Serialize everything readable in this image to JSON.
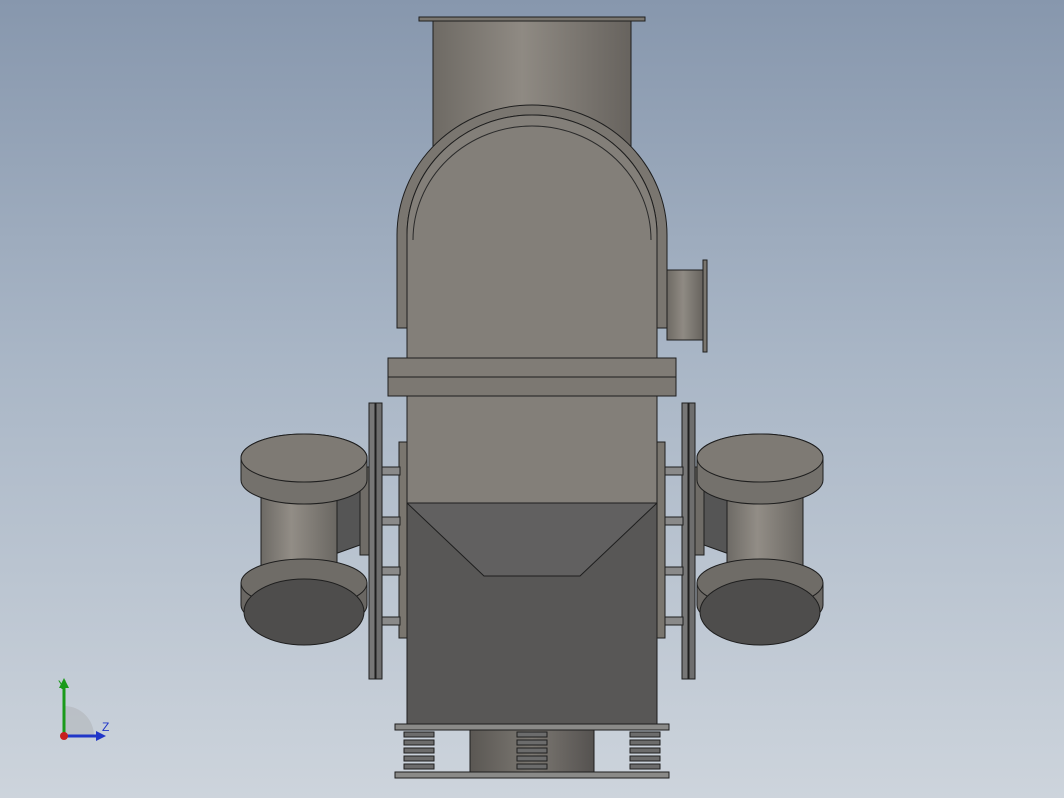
{
  "viewport": {
    "model": "vibrating-motor-feeder-front-view"
  },
  "triad": {
    "y_label": "Y",
    "z_label": "Z",
    "colors": {
      "y": "#1a9a1a",
      "z": "#2036c8",
      "x": "#c81e1e"
    }
  },
  "colors": {
    "background_top": "#8797ad",
    "background_bottom": "#cdd4dc",
    "body_light": "#858078",
    "body_dark": "#5a5a58",
    "edge": "#1e1e1e"
  }
}
